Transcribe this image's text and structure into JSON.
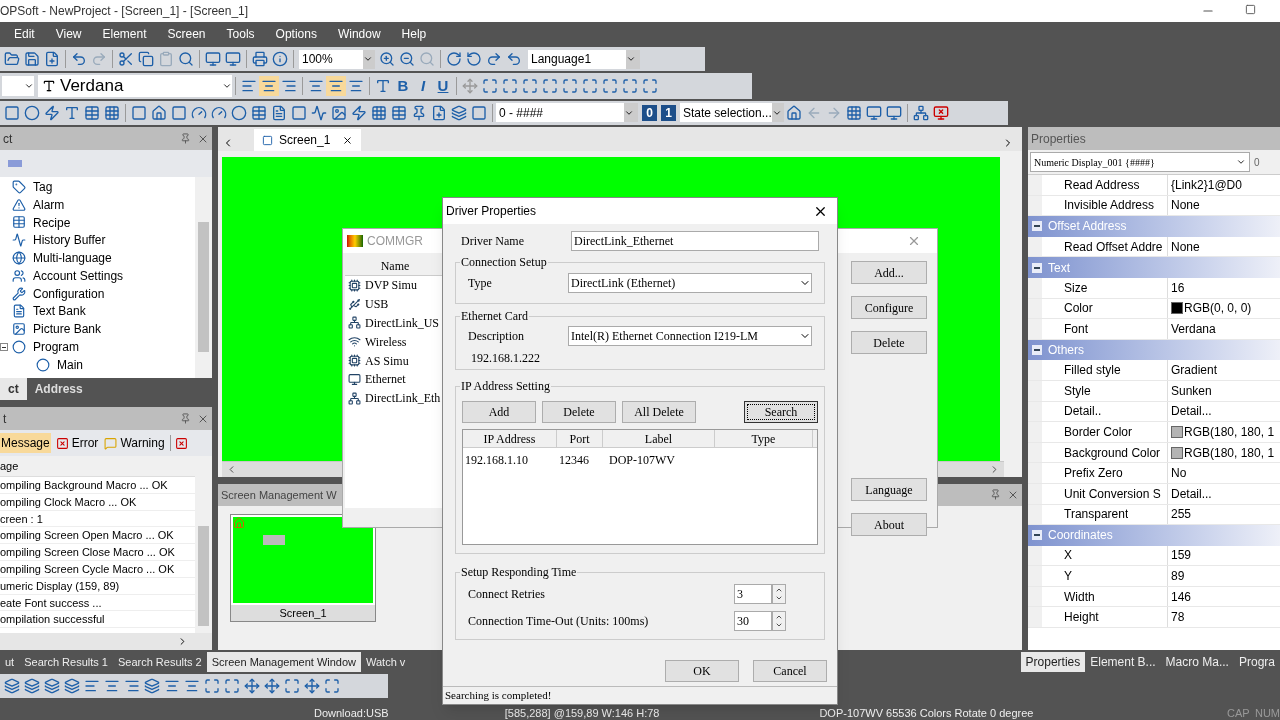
{
  "app_title": "OPSoft - NewProject - [Screen_1] - [Screen_1]",
  "menu": [
    "Edit",
    "View",
    "Element",
    "Screen",
    "Tools",
    "Options",
    "Window",
    "Help"
  ],
  "toolbar": {
    "zoom": "100%",
    "language": "Language1",
    "font": "Verdana",
    "text_styles": [
      "B",
      "I",
      "U"
    ],
    "format": "0 - ####",
    "bits": [
      "0",
      "1"
    ],
    "state": "State selection..."
  },
  "project_panel": {
    "title": "ct",
    "tree": [
      {
        "label": "Tag"
      },
      {
        "label": "Alarm"
      },
      {
        "label": "Recipe"
      },
      {
        "label": "History Buffer"
      },
      {
        "label": "Multi-language"
      },
      {
        "label": "Account Settings"
      },
      {
        "label": "Configuration"
      },
      {
        "label": "Text Bank"
      },
      {
        "label": "Picture Bank"
      },
      {
        "label": "Program",
        "expanded": true,
        "children": [
          {
            "label": "Main"
          }
        ]
      }
    ],
    "tabs": [
      {
        "label": "ct",
        "selected": true
      },
      {
        "label": "Address",
        "selected": false
      }
    ]
  },
  "output_panel": {
    "title": "t",
    "filters": [
      {
        "label": "Message",
        "selected": true
      },
      {
        "label": "Error",
        "selected": false
      },
      {
        "label": "Warning",
        "selected": false
      }
    ],
    "column": "age",
    "rows": [
      "ompiling Background Macro ... OK",
      "ompiling Clock Macro ... OK",
      "creen : 1",
      "ompiling Screen Open Macro ... OK",
      "ompiling Screen Close Macro ... OK",
      "ompiling Screen Cycle Macro ... OK",
      "umeric Display (159, 89)",
      "eate Font success ...",
      "ompilation successful"
    ]
  },
  "bottom_tabs": [
    {
      "label": "ut",
      "selected": false
    },
    {
      "label": "Search Results 1",
      "selected": false
    },
    {
      "label": "Search Results 2",
      "selected": false
    },
    {
      "label": "Screen Management Window",
      "selected": true
    },
    {
      "label": "Watch v",
      "selected": false
    }
  ],
  "document_tab": "Screen_1",
  "screen_management": {
    "title": "Screen Management W",
    "thumbnail": "Screen_1"
  },
  "commgr": {
    "title": "COMMGR",
    "column": "Name",
    "items": [
      "DVP Simu",
      "USB",
      "DirectLink_US",
      "Wireless",
      "AS Simu",
      "Ethernet",
      "DirectLink_Eth"
    ],
    "buttons": [
      "Add...",
      "Configure",
      "Delete"
    ],
    "lower_buttons": [
      "Language",
      "About"
    ]
  },
  "dialog": {
    "title": "Driver Properties",
    "driver_name_label": "Driver Name",
    "driver_name": "DirectLink_Ethernet",
    "connection_group": "Connection Setup",
    "type_label": "Type",
    "type": "DirectLink (Ethernet)",
    "card_group": "Ethernet Card",
    "description_label": "Description",
    "description": "Intel(R) Ethernet Connection I219-LM",
    "local_ip": "192.168.1.222",
    "ip_group": "IP Address Setting",
    "ip_buttons": [
      "Add",
      "Delete",
      "All Delete",
      "Search"
    ],
    "columns": [
      "IP Address",
      "Port",
      "Label",
      "Type"
    ],
    "rows": [
      [
        "192.168.1.10",
        "12346",
        "DOP-107WV",
        ""
      ]
    ],
    "timing_group": "Setup Responding Time",
    "retries_label": "Connect Retries",
    "retries": "3",
    "timeout_label": "Connection Time-Out (Units: 100ms)",
    "timeout": "30",
    "ok": "OK",
    "cancel": "Cancel",
    "status": "Searching is completed!"
  },
  "properties": {
    "title": "Properties",
    "selector": "Numeric Display_001 {####}",
    "selector_extra": "0",
    "rows": [
      {
        "label": "Read Address",
        "value": "{Link2}1@D0"
      },
      {
        "label": "Invisible Address",
        "value": "None"
      }
    ],
    "groups": [
      {
        "label": "Offset Address",
        "expanded": true,
        "rows": [
          {
            "label": "Read Offset Addre",
            "value": "None"
          }
        ]
      },
      {
        "label": "Text",
        "expanded": true,
        "rows": [
          {
            "label": "Size",
            "value": "16"
          },
          {
            "label": "Color",
            "value": "RGB(0, 0, 0)",
            "color": "#000000"
          },
          {
            "label": "Font",
            "value": "Verdana"
          }
        ]
      },
      {
        "label": "Others",
        "expanded": true,
        "rows": [
          {
            "label": "Filled style",
            "value": "Gradient"
          },
          {
            "label": "Style",
            "value": "Sunken"
          },
          {
            "label": "Detail..",
            "value": "Detail..."
          },
          {
            "label": "Border Color",
            "value": "RGB(180, 180, 1",
            "color": "#b4b4b4"
          },
          {
            "label": "Background Color",
            "value": "RGB(180, 180, 1",
            "color": "#b4b4b4"
          },
          {
            "label": "Prefix Zero",
            "value": "No"
          },
          {
            "label": "Unit Conversion S",
            "value": "Detail..."
          },
          {
            "label": "Transparent",
            "value": "255"
          }
        ]
      },
      {
        "label": "Coordinates",
        "expanded": true,
        "rows": [
          {
            "label": "X",
            "value": "159"
          },
          {
            "label": "Y",
            "value": "89"
          },
          {
            "label": "Width",
            "value": "146"
          },
          {
            "label": "Height",
            "value": "78"
          }
        ]
      }
    ],
    "tabs": [
      {
        "label": "Properties",
        "selected": true
      },
      {
        "label": "Element B...",
        "selected": false
      },
      {
        "label": "Macro Ma...",
        "selected": false
      },
      {
        "label": "Progra",
        "selected": false
      }
    ]
  },
  "status_bar": [
    "Download:USB",
    "[585,288] @159,89 W:146 H:78",
    "DOP-107WV 65536 Colors Rotate 0 degree",
    "CAP",
    "NUM"
  ]
}
